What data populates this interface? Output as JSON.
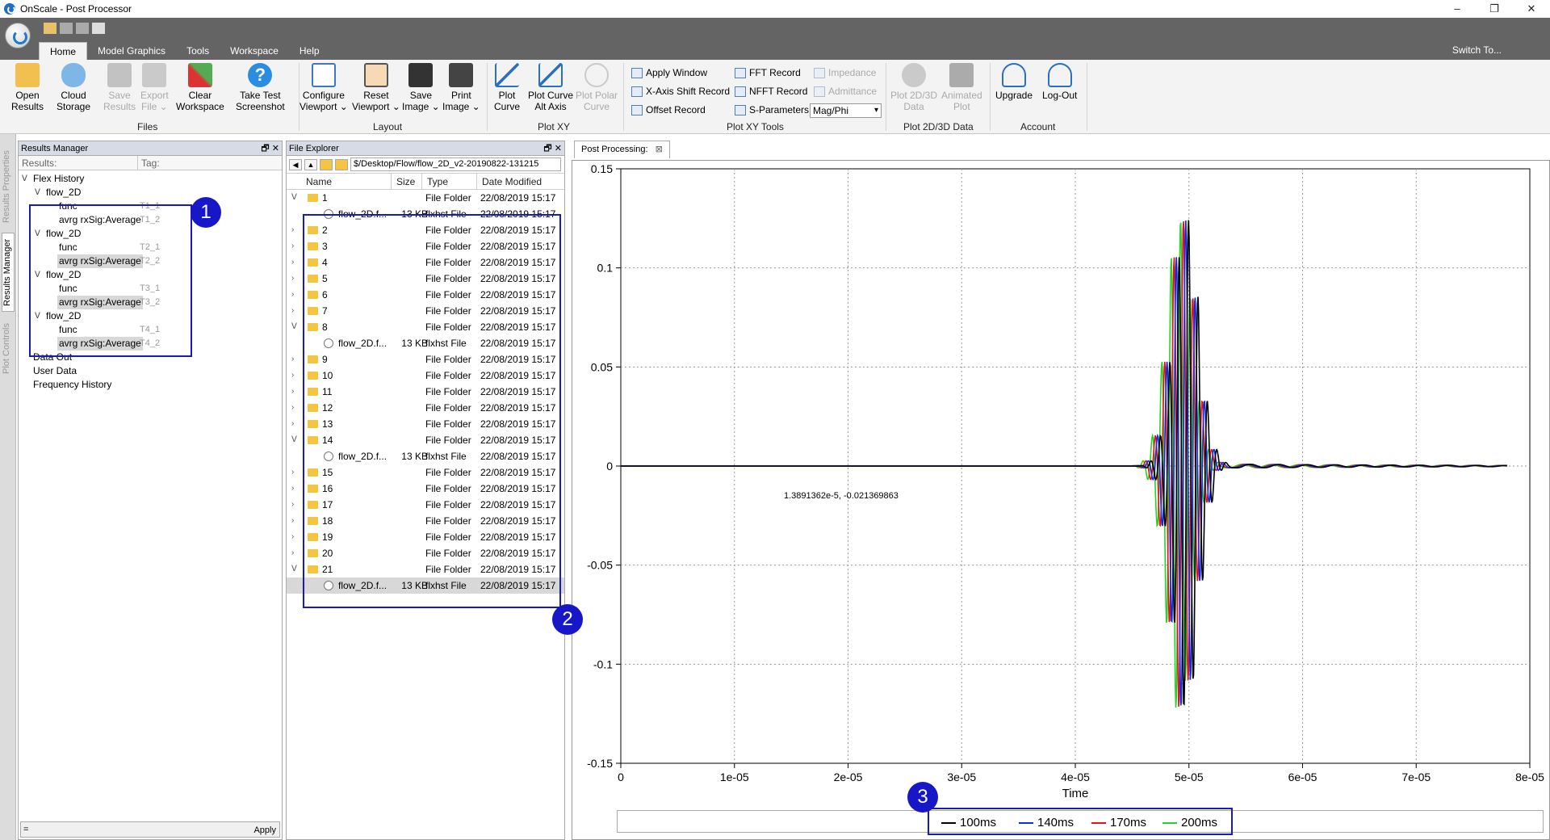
{
  "window": {
    "title": "OnScale - Post Processor",
    "minimize": "–",
    "maximize": "❐",
    "close": "✕"
  },
  "ribbon_tabs": [
    "Home",
    "Model Graphics",
    "Tools",
    "Workspace",
    "Help"
  ],
  "switch_to": "Switch To...",
  "ribbon": {
    "files": {
      "label": "Files",
      "open_results": [
        "Open",
        "Results"
      ],
      "cloud_storage": [
        "Cloud",
        "Storage"
      ],
      "save_results": [
        "Save",
        "Results"
      ],
      "export_file": [
        "Export",
        "File ⌄"
      ],
      "clear_workspace": [
        "Clear",
        "Workspace"
      ],
      "take_test_screenshot": [
        "Take Test",
        "Screenshot"
      ]
    },
    "layout": {
      "label": "Layout",
      "configure_viewport": [
        "Configure",
        "Viewport ⌄"
      ],
      "reset_viewport": [
        "Reset",
        "Viewport ⌄"
      ],
      "save_image": [
        "Save",
        "Image ⌄"
      ],
      "print_image": [
        "Print",
        "Image ⌄"
      ]
    },
    "plotxy": {
      "label": "Plot XY",
      "plot_curve": [
        "Plot",
        "Curve"
      ],
      "plot_curve_alt": [
        "Plot Curve",
        "Alt Axis"
      ],
      "plot_polar": [
        "Plot Polar",
        "Curve"
      ]
    },
    "tools": {
      "label": "Plot XY Tools",
      "apply_window": "Apply Window",
      "xaxis_shift": "X-Axis Shift Record",
      "offset_record": "Offset Record",
      "fft_record": "FFT Record",
      "nfft_record": "NFFT Record",
      "s_parameters": "S-Parameters",
      "impedance": "Impedance",
      "admittance": "Admittance",
      "mode": "Mag/Phi"
    },
    "plot2d3d": {
      "label": "Plot 2D/3D Data",
      "plot_data": [
        "Plot 2D/3D",
        "Data"
      ],
      "animated_plot": [
        "Animated",
        "Plot"
      ]
    },
    "account": {
      "label": "Account",
      "upgrade": "Upgrade",
      "logout": "Log-Out"
    }
  },
  "side_tabs": [
    "Results Properties",
    "Results Manager",
    "Plot Controls"
  ],
  "results_manager": {
    "title": "Results Manager",
    "col_results": "Results:",
    "col_tag": "Tag:",
    "root": "Flex History",
    "groups": [
      {
        "name": "flow_2D",
        "items": [
          {
            "name": "func",
            "tag": "T1_1"
          },
          {
            "name": "avrg rxSig:Average",
            "tag": "T1_2"
          }
        ]
      },
      {
        "name": "flow_2D",
        "items": [
          {
            "name": "func",
            "tag": "T2_1"
          },
          {
            "name": "avrg rxSig:Average",
            "tag": "T2_2"
          }
        ]
      },
      {
        "name": "flow_2D",
        "items": [
          {
            "name": "func",
            "tag": "T3_1"
          },
          {
            "name": "avrg rxSig:Average",
            "tag": "T3_2"
          }
        ]
      },
      {
        "name": "flow_2D",
        "items": [
          {
            "name": "func",
            "tag": "T4_1"
          },
          {
            "name": "avrg rxSig:Average",
            "tag": "T4_2"
          }
        ]
      }
    ],
    "extra": [
      "Data Out",
      "User Data",
      "Frequency History"
    ],
    "filter_value": "=",
    "apply": "Apply"
  },
  "file_explorer": {
    "title": "File Explorer",
    "path": "$/Desktop/Flow/flow_2D_v2-20190822-131215",
    "columns": [
      "Name",
      "Size",
      "Type",
      "Date Modified"
    ],
    "rows": [
      {
        "name": "1",
        "kind": "folder",
        "expanded": true,
        "size": "",
        "type": "File Folder",
        "date": "22/08/2019 15:17"
      },
      {
        "name": "flow_2D.f...",
        "kind": "file",
        "size": "13 KB",
        "type": "flxhst File",
        "date": "22/08/2019 15:17"
      },
      {
        "name": "2",
        "kind": "folder",
        "size": "",
        "type": "File Folder",
        "date": "22/08/2019 15:17"
      },
      {
        "name": "3",
        "kind": "folder",
        "size": "",
        "type": "File Folder",
        "date": "22/08/2019 15:17"
      },
      {
        "name": "4",
        "kind": "folder",
        "size": "",
        "type": "File Folder",
        "date": "22/08/2019 15:17"
      },
      {
        "name": "5",
        "kind": "folder",
        "size": "",
        "type": "File Folder",
        "date": "22/08/2019 15:17"
      },
      {
        "name": "6",
        "kind": "folder",
        "size": "",
        "type": "File Folder",
        "date": "22/08/2019 15:17"
      },
      {
        "name": "7",
        "kind": "folder",
        "size": "",
        "type": "File Folder",
        "date": "22/08/2019 15:17"
      },
      {
        "name": "8",
        "kind": "folder",
        "expanded": true,
        "size": "",
        "type": "File Folder",
        "date": "22/08/2019 15:17"
      },
      {
        "name": "flow_2D.f...",
        "kind": "file",
        "size": "13 KB",
        "type": "flxhst File",
        "date": "22/08/2019 15:17"
      },
      {
        "name": "9",
        "kind": "folder",
        "size": "",
        "type": "File Folder",
        "date": "22/08/2019 15:17"
      },
      {
        "name": "10",
        "kind": "folder",
        "size": "",
        "type": "File Folder",
        "date": "22/08/2019 15:17"
      },
      {
        "name": "11",
        "kind": "folder",
        "size": "",
        "type": "File Folder",
        "date": "22/08/2019 15:17"
      },
      {
        "name": "12",
        "kind": "folder",
        "size": "",
        "type": "File Folder",
        "date": "22/08/2019 15:17"
      },
      {
        "name": "13",
        "kind": "folder",
        "size": "",
        "type": "File Folder",
        "date": "22/08/2019 15:17"
      },
      {
        "name": "14",
        "kind": "folder",
        "expanded": true,
        "size": "",
        "type": "File Folder",
        "date": "22/08/2019 15:17"
      },
      {
        "name": "flow_2D.f...",
        "kind": "file",
        "size": "13 KB",
        "type": "flxhst File",
        "date": "22/08/2019 15:17"
      },
      {
        "name": "15",
        "kind": "folder",
        "size": "",
        "type": "File Folder",
        "date": "22/08/2019 15:17"
      },
      {
        "name": "16",
        "kind": "folder",
        "size": "",
        "type": "File Folder",
        "date": "22/08/2019 15:17"
      },
      {
        "name": "17",
        "kind": "folder",
        "size": "",
        "type": "File Folder",
        "date": "22/08/2019 15:17"
      },
      {
        "name": "18",
        "kind": "folder",
        "size": "",
        "type": "File Folder",
        "date": "22/08/2019 15:17"
      },
      {
        "name": "19",
        "kind": "folder",
        "size": "",
        "type": "File Folder",
        "date": "22/08/2019 15:17"
      },
      {
        "name": "20",
        "kind": "folder",
        "size": "",
        "type": "File Folder",
        "date": "22/08/2019 15:17"
      },
      {
        "name": "21",
        "kind": "folder",
        "expanded": true,
        "size": "",
        "type": "File Folder",
        "date": "22/08/2019 15:17"
      },
      {
        "name": "flow_2D.f...",
        "kind": "file",
        "size": "13 KB",
        "type": "flxhst File",
        "date": "22/08/2019 15:17",
        "selected": true
      }
    ]
  },
  "post_processing": {
    "tab": "Post Processing:",
    "close": "⊠"
  },
  "annotations": [
    "1",
    "2",
    "3"
  ],
  "chart_data": {
    "type": "line",
    "xlabel": "Time",
    "ylabel": "",
    "xlim": [
      0,
      8e-05
    ],
    "ylim": [
      -0.15,
      0.15
    ],
    "x_ticks": [
      "0",
      "1e-05",
      "2e-05",
      "3e-05",
      "4e-05",
      "5e-05",
      "6e-05",
      "7e-05",
      "8e-05"
    ],
    "y_ticks": [
      "0.15",
      "0.1",
      "0.05",
      "0",
      "-0.05",
      "-0.1",
      "-0.15"
    ],
    "grid": true,
    "cursor_readout": "1.3891362e-5, -0.021369863",
    "legend_position": "bottom",
    "series": [
      {
        "name": "100ms",
        "color": "#000000",
        "delay": 0.0
      },
      {
        "name": "140ms",
        "color": "#0a2ee8",
        "delay": -2.5e-07
      },
      {
        "name": "170ms",
        "color": "#e8101a",
        "delay": -4.5e-07
      },
      {
        "name": "200ms",
        "color": "#2ad12a",
        "delay": -7e-07
      }
    ],
    "peaks": {
      "max": 0.113,
      "min": -0.128,
      "center_x": 4.98e-05
    }
  }
}
